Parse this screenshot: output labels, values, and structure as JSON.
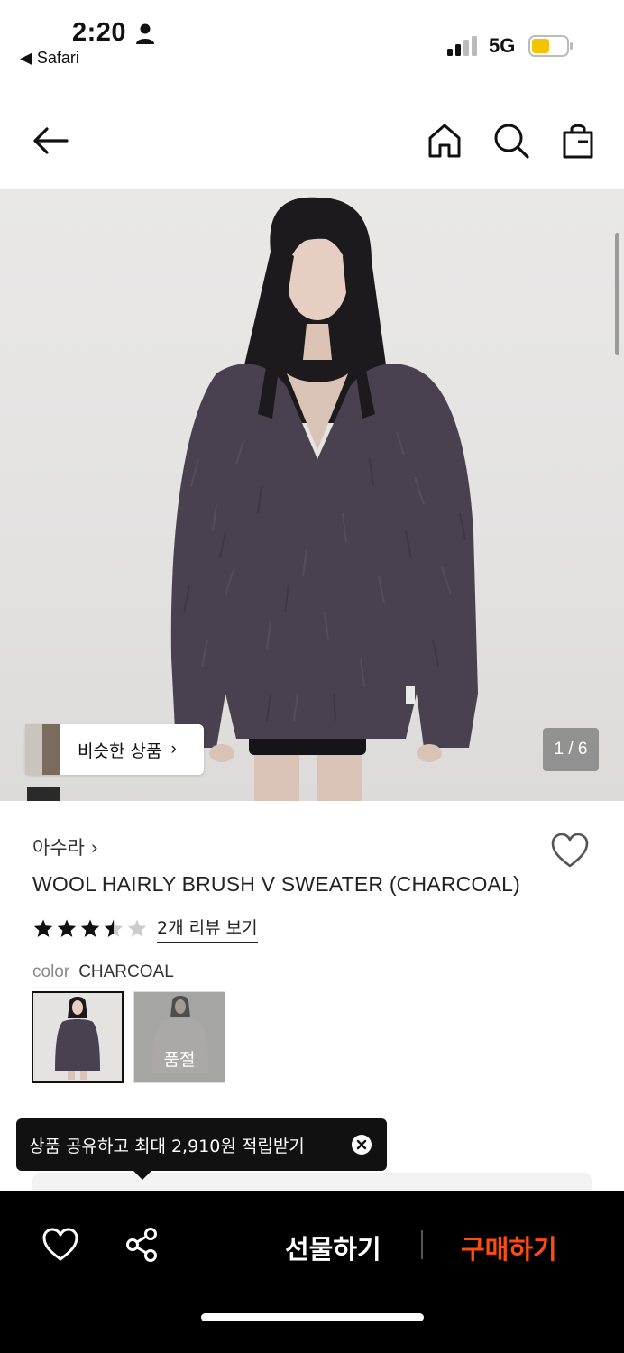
{
  "status_bar": {
    "time": "2:20",
    "back_app": "◀ Safari",
    "network": "5G",
    "battery_color": "#f5c400"
  },
  "nav": {
    "icons": [
      "back-arrow-icon",
      "home-icon",
      "search-icon",
      "shopping-bag-icon"
    ]
  },
  "gallery": {
    "similar_label": "비슷한 상품",
    "similar_chevron": "›",
    "page_indicator": "1 / 6"
  },
  "product": {
    "brand": "아수라 ›",
    "title": "WOOL HAIRLY BRUSH V SWEATER (CHARCOAL)",
    "rating": 3.5,
    "reviews_link": "2개 리뷰 보기",
    "color_label": "color",
    "color_value": "CHARCOAL",
    "soldout_label": "품절",
    "sweater_color": "#4a4150"
  },
  "tooltip": {
    "text": "상품 공유하고 최대 2,910원 적립받기"
  },
  "bottom_bar": {
    "gift_label": "선물하기",
    "buy_label": "구매하기",
    "buy_color": "#ff4a10"
  }
}
